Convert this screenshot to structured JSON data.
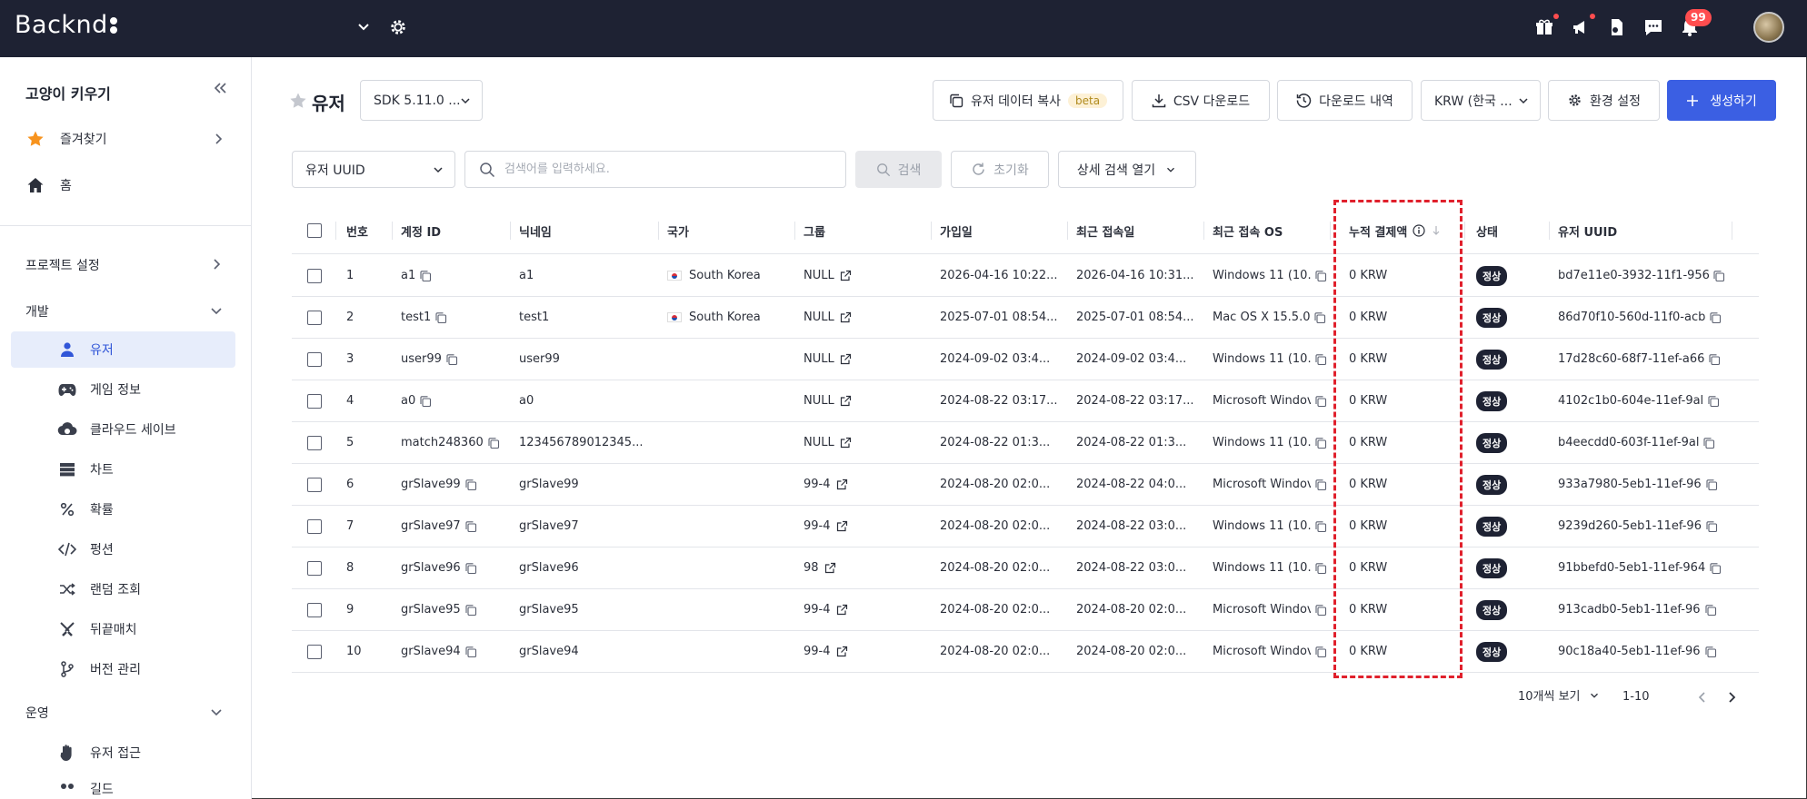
{
  "app": {
    "logo": "Backnd"
  },
  "topbar": {
    "notification_count": "99"
  },
  "sidebar": {
    "project_name": "고양이 키우기",
    "favorites": "즐겨찾기",
    "home": "홈",
    "project_settings": "프로젝트 설정",
    "dev_section": "개발",
    "dev_items": [
      {
        "label": "유저",
        "icon": "user-icon"
      },
      {
        "label": "게임 정보",
        "icon": "gamepad-icon"
      },
      {
        "label": "클라우드 세이브",
        "icon": "cloud-save-icon"
      },
      {
        "label": "차트",
        "icon": "chart-list-icon"
      },
      {
        "label": "확률",
        "icon": "percent-icon"
      },
      {
        "label": "펑션",
        "icon": "code-icon"
      },
      {
        "label": "랜덤 조회",
        "icon": "shuffle-icon"
      },
      {
        "label": "뒤끝매치",
        "icon": "swords-icon"
      },
      {
        "label": "버전 관리",
        "icon": "branch-icon"
      }
    ],
    "ops_section": "운영",
    "ops_items": [
      {
        "label": "유저 접근",
        "icon": "hand-icon"
      },
      {
        "label": "길드",
        "icon": "guild-icon"
      }
    ]
  },
  "header": {
    "title": "유저",
    "sdk_select": "SDK 5.11.0 ...",
    "copy_user_data": "유저 데이터 복사",
    "beta": "beta",
    "csv_download": "CSV 다운로드",
    "download_history": "다운로드 내역",
    "currency_select": "KRW (한국 ...",
    "env_settings": "환경 설정",
    "create": "생성하기"
  },
  "search": {
    "field_select": "유저 UUID",
    "placeholder": "검색어를 입력하세요.",
    "search_btn": "검색",
    "reset_btn": "초기화",
    "advanced_btn": "상세 검색 열기"
  },
  "table": {
    "columns": {
      "no": "번호",
      "account_id": "계정 ID",
      "nickname": "닉네임",
      "country": "국가",
      "group": "그룹",
      "joined": "가입일",
      "last_login": "최근 접속일",
      "last_os": "최근 접속 OS",
      "total_payment": "누적 결제액",
      "status": "상태",
      "uuid": "유저 UUID"
    },
    "rows": [
      {
        "no": "1",
        "account_id": "a1",
        "nickname": "a1",
        "country": "South Korea",
        "group": "NULL",
        "joined": "2026-04-16 10:22...",
        "last_login": "2026-04-16 10:31...",
        "os": "Windows 11 (10.0",
        "payment": "0 KRW",
        "status": "정상",
        "uuid": "bd7e11e0-3932-11f1-956"
      },
      {
        "no": "2",
        "account_id": "test1",
        "nickname": "test1",
        "country": "South Korea",
        "group": "NULL",
        "joined": "2025-07-01 08:54...",
        "last_login": "2025-07-01 08:54...",
        "os": "Mac OS X 15.5.0",
        "payment": "0 KRW",
        "status": "정상",
        "uuid": "86d70f10-560d-11f0-acb"
      },
      {
        "no": "3",
        "account_id": "user99",
        "nickname": "user99",
        "country": "",
        "group": "NULL",
        "joined": "2024-09-02 03:4...",
        "last_login": "2024-09-02 03:4...",
        "os": "Windows 11 (10.0",
        "payment": "0 KRW",
        "status": "정상",
        "uuid": "17d28c60-68f7-11ef-a66"
      },
      {
        "no": "4",
        "account_id": "a0",
        "nickname": "a0",
        "country": "",
        "group": "NULL",
        "joined": "2024-08-22 03:17...",
        "last_login": "2024-08-22 03:17...",
        "os": "Microsoft Windov",
        "payment": "0 KRW",
        "status": "정상",
        "uuid": "4102c1b0-604e-11ef-9al"
      },
      {
        "no": "5",
        "account_id": "match248360",
        "nickname": "123456789012345...",
        "country": "",
        "group": "NULL",
        "joined": "2024-08-22 01:3...",
        "last_login": "2024-08-22 01:3...",
        "os": "Windows 11 (10.0",
        "payment": "0 KRW",
        "status": "정상",
        "uuid": "b4eecdd0-603f-11ef-9al"
      },
      {
        "no": "6",
        "account_id": "grSlave99",
        "nickname": "grSlave99",
        "country": "",
        "group": "99-4",
        "joined": "2024-08-20 02:0...",
        "last_login": "2024-08-22 04:0...",
        "os": "Microsoft Windov",
        "payment": "0 KRW",
        "status": "정상",
        "uuid": "933a7980-5eb1-11ef-96"
      },
      {
        "no": "7",
        "account_id": "grSlave97",
        "nickname": "grSlave97",
        "country": "",
        "group": "99-4",
        "joined": "2024-08-20 02:0...",
        "last_login": "2024-08-22 03:0...",
        "os": "Windows 11 (10.0",
        "payment": "0 KRW",
        "status": "정상",
        "uuid": "9239d260-5eb1-11ef-96"
      },
      {
        "no": "8",
        "account_id": "grSlave96",
        "nickname": "grSlave96",
        "country": "",
        "group": "98",
        "joined": "2024-08-20 02:0...",
        "last_login": "2024-08-22 03:0...",
        "os": "Windows 11 (10.0",
        "payment": "0 KRW",
        "status": "정상",
        "uuid": "91bbefd0-5eb1-11ef-964"
      },
      {
        "no": "9",
        "account_id": "grSlave95",
        "nickname": "grSlave95",
        "country": "",
        "group": "99-4",
        "joined": "2024-08-20 02:0...",
        "last_login": "2024-08-20 02:0...",
        "os": "Microsoft Windov",
        "payment": "0 KRW",
        "status": "정상",
        "uuid": "913cadb0-5eb1-11ef-96"
      },
      {
        "no": "10",
        "account_id": "grSlave94",
        "nickname": "grSlave94",
        "country": "",
        "group": "99-4",
        "joined": "2024-08-20 02:0...",
        "last_login": "2024-08-20 02:0...",
        "os": "Microsoft Windov",
        "payment": "0 KRW",
        "status": "정상",
        "uuid": "90c18a40-5eb1-11ef-96"
      }
    ]
  },
  "pagination": {
    "page_size": "10개씩 보기",
    "range": "1-10"
  },
  "colors": {
    "topbar": "#1e2233",
    "primary": "#3b5fe3",
    "active_bg": "#e7edfb",
    "highlight": "#e0202c"
  }
}
